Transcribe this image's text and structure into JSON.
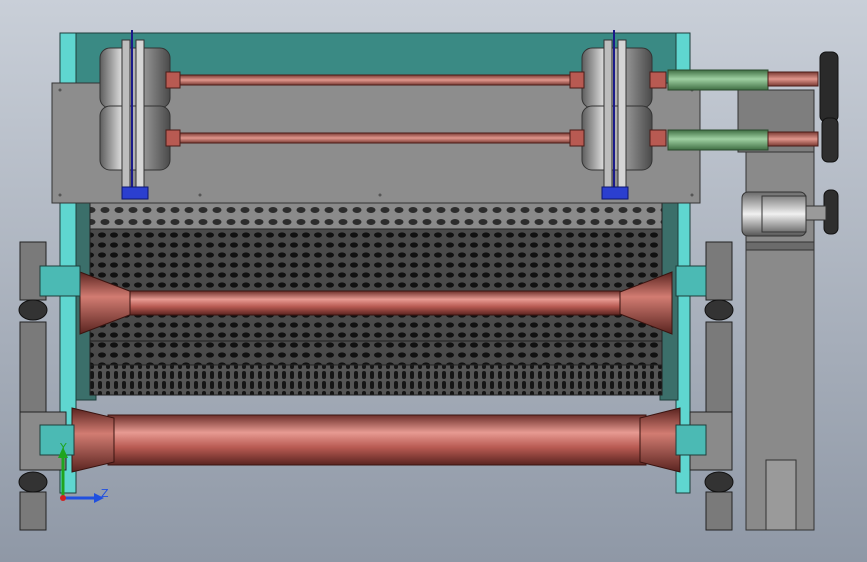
{
  "viewport": {
    "background_top": "#c9cfd8",
    "background_bottom": "#8f98a6"
  },
  "triad": {
    "y_label": "Y",
    "z_label": "Z",
    "x_color": "#d32020",
    "y_color": "#1fa51f",
    "z_color": "#2050e0"
  },
  "colors": {
    "frame_teal": "#3a8a84",
    "frame_cyan": "#5fd6d0",
    "shaft_red": "#b85a52",
    "shaft_red_light": "#e79a92",
    "pulley_grey": "#9a9a9a",
    "mesh_dark": "#3b3b3b",
    "sleeve_green": "#5f9a64",
    "bearing_blue": "#2b3fd0",
    "plate_grey": "#8d8d8d"
  }
}
